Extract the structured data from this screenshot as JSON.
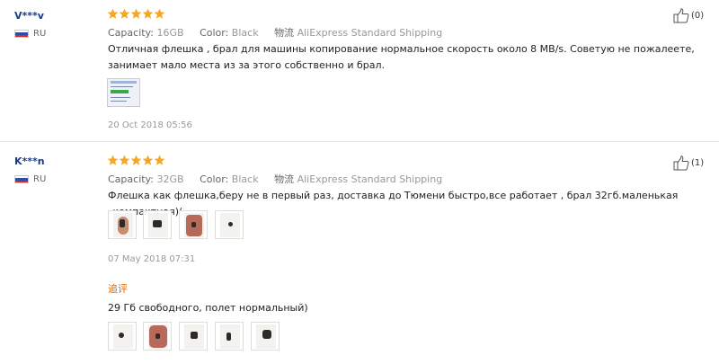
{
  "reviews": [
    {
      "user": "V***v",
      "country": "RU",
      "rating": 5,
      "capacity_label": "Capacity:",
      "capacity_value": "16GB",
      "color_label": "Color:",
      "color_value": "Black",
      "logistics_label": "物流",
      "shipping": "AliExpress Standard Shipping",
      "text": "Отличная флешка , брал для машины копирование нормальное скорость около 8 MB/s. Советую не пожалеете, занимает мало места из за этого собственно и брал.",
      "date": "20 Oct 2018 05:56",
      "likes": "(0)"
    },
    {
      "user": "K***n",
      "country": "RU",
      "rating": 5,
      "capacity_label": "Capacity:",
      "capacity_value": "32GB",
      "color_label": "Color:",
      "color_value": "Black",
      "logistics_label": "物流",
      "shipping": "AliExpress Standard Shipping",
      "text": "Флешка как флешка,беру не в первый раз, доставка до Тюмени быстро,все работает , брал 32гб.маленькая _компактная)(",
      "date": "07 May 2018 07:31",
      "likes": "(1)",
      "followup_label": "追评",
      "followup_text": "29 Гб свободного, полет нормальный)"
    }
  ],
  "colors": {
    "star": "#f5a623",
    "user_name": "#1a3a8a",
    "followup": "#e06a00",
    "meta": "#999999"
  },
  "icons": {
    "star": "star-icon",
    "like": "thumbs-up-icon",
    "flag": "russia-flag-icon"
  }
}
